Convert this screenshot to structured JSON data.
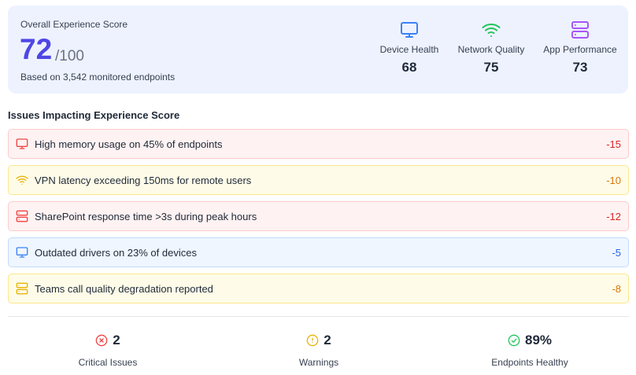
{
  "score": {
    "label": "Overall Experience Score",
    "value": "72",
    "max": "/100",
    "subtitle": "Based on 3,542 monitored endpoints",
    "accent_color": "#4f46e5"
  },
  "metrics": [
    {
      "label": "Device Health",
      "value": "68",
      "icon": "monitor-icon",
      "color": "#3b82f6"
    },
    {
      "label": "Network Quality",
      "value": "75",
      "icon": "wifi-icon",
      "color": "#22c55e"
    },
    {
      "label": "App Performance",
      "value": "73",
      "icon": "server-icon",
      "color": "#a855f7"
    }
  ],
  "issues_title": "Issues Impacting Experience Score",
  "issues": [
    {
      "text": "High memory usage on 45% of endpoints",
      "impact": "-15",
      "severity": "red",
      "icon": "monitor-icon"
    },
    {
      "text": "VPN latency exceeding 150ms for remote users",
      "impact": "-10",
      "severity": "yellow",
      "icon": "wifi-icon"
    },
    {
      "text": "SharePoint response time >3s during peak hours",
      "impact": "-12",
      "severity": "red",
      "icon": "server-icon"
    },
    {
      "text": "Outdated drivers on 23% of devices",
      "impact": "-5",
      "severity": "blue",
      "icon": "monitor-icon"
    },
    {
      "text": "Teams call quality degradation reported",
      "impact": "-8",
      "severity": "yellow",
      "icon": "server-icon"
    }
  ],
  "summary": [
    {
      "value": "2",
      "label": "Critical Issues",
      "icon": "x-circle-icon",
      "color": "#ef4444"
    },
    {
      "value": "2",
      "label": "Warnings",
      "icon": "alert-circle-icon",
      "color": "#eab308"
    },
    {
      "value": "89%",
      "label": "Endpoints Healthy",
      "icon": "check-circle-icon",
      "color": "#22c55e"
    }
  ]
}
